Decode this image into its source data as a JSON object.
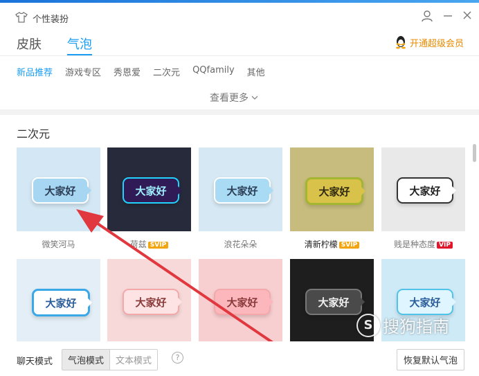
{
  "window": {
    "title": "个性装扮"
  },
  "tabs": [
    {
      "label": "皮肤",
      "active": false
    },
    {
      "label": "气泡",
      "active": true
    }
  ],
  "vip_link": "开通超级会员",
  "categories": [
    "新品推荐",
    "游戏专区",
    "秀恩爱",
    "二次元",
    "QQfamily",
    "其他"
  ],
  "see_more": "查看更多",
  "section": {
    "title": "二次元"
  },
  "bubble_text": "大家好",
  "items": [
    {
      "name": "微笑河马",
      "badge": "",
      "bg": "#d3e7f4",
      "bubble_bg": "#a7d6f2",
      "bubble_fg": "#2c3f57",
      "icon": "cloud-bubble-icon"
    },
    {
      "name": "荷兹",
      "badge": "SVIP",
      "bg": "#262a3a",
      "bubble_bg": "#311b57",
      "bubble_fg": "#9ef0ff",
      "icon": "neon-cat-bubble-icon"
    },
    {
      "name": "浪花朵朵",
      "badge": "",
      "bg": "#d6e8f3",
      "bubble_bg": "#a9dbf4",
      "bubble_fg": "#2c3f57",
      "icon": "wave-bubble-icon"
    },
    {
      "name": "清新柠檬",
      "badge": "SVIP",
      "bg": "#c7bc7e",
      "bubble_bg": "#d8c24a",
      "bubble_fg": "#2f2a10",
      "icon": "lemon-bubble-icon"
    },
    {
      "name": "贱是种态度",
      "badge": "VIP",
      "bg": "#e9e9e9",
      "bubble_bg": "#ffffff",
      "bubble_fg": "#222222",
      "icon": "sketch-bubble-icon"
    },
    {
      "name": "",
      "badge": "",
      "bg": "#e4eef6",
      "bubble_bg": "#ffffff",
      "bubble_fg": "#2a5d9a",
      "icon": "blue-frame-bubble-icon"
    },
    {
      "name": "",
      "badge": "",
      "bg": "#f7d9d9",
      "bubble_bg": "#fde3e3",
      "bubble_fg": "#8a3a3a",
      "icon": "pig-bubble-icon"
    },
    {
      "name": "",
      "badge": "",
      "bg": "#f8cfd1",
      "bubble_bg": "#fbb7bb",
      "bubble_fg": "#8a3a3a",
      "icon": "pink-bubble-icon"
    },
    {
      "name": "",
      "badge": "",
      "bg": "#1e1e1e",
      "bubble_bg": "#4a4a4a",
      "bubble_fg": "#f0f0f0",
      "icon": "dark-cat-bubble-icon"
    },
    {
      "name": "",
      "badge": "",
      "bg": "#cfeaf7",
      "bubble_bg": "#dff5ff",
      "bubble_fg": "#2a5d9a",
      "icon": "duck-bubble-icon"
    }
  ],
  "bottom": {
    "chat_mode_label": "聊天模式",
    "modes": [
      {
        "label": "气泡模式",
        "active": true
      },
      {
        "label": "文本模式",
        "active": false
      }
    ],
    "help": "?",
    "restore_button": "恢复默认气泡"
  },
  "colors": {
    "accent": "#1a9df5",
    "vip": "#e68a00",
    "arrow": "#e0383e"
  },
  "watermark": {
    "text": "搜狗指南",
    "letter": "S"
  }
}
